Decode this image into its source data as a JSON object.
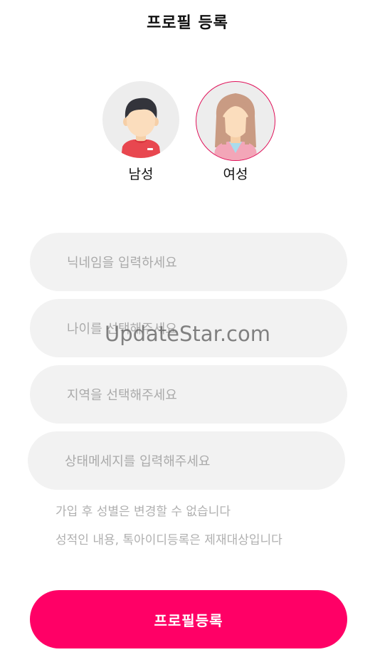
{
  "header": {
    "title": "프로필 등록"
  },
  "gender": {
    "male_label": "남성",
    "female_label": "여성",
    "selected": "여성",
    "male_icon": "male-avatar-icon",
    "female_icon": "female-avatar-icon"
  },
  "form": {
    "nickname_placeholder": "닉네임을 입력하세요",
    "age_placeholder": "나이를 선택해주세요",
    "region_placeholder": "지역을 선택해주세요",
    "status_placeholder": "상태메세지를 입력해주세요"
  },
  "notes": {
    "gender_notice": "가입 후 성별은 변경할 수 없습니다",
    "content_notice": "성적인 내용, 톡아이디등록은 제재대상입니다"
  },
  "watermark": "UpdateStar.com",
  "submit": {
    "label": "프로필등록"
  },
  "colors": {
    "accent": "#ff0066",
    "selected_border": "#e0125a",
    "field_bg": "#f2f2f2",
    "placeholder": "#aaaaaa"
  }
}
